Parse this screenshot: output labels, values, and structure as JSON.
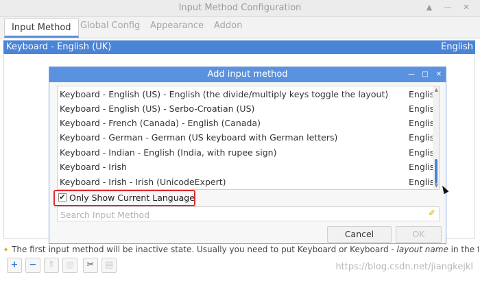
{
  "window": {
    "title": "Input Method Configuration",
    "controls": [
      "▲",
      "—",
      "✕"
    ]
  },
  "tabs": [
    {
      "label": "Input Method",
      "active": true
    },
    {
      "label": "Global Config",
      "active": false
    },
    {
      "label": "Appearance",
      "active": false
    },
    {
      "label": "Addon",
      "active": false
    }
  ],
  "main_list": {
    "selected": {
      "name": "Keyboard - English (UK)",
      "lang": "English"
    }
  },
  "dialog": {
    "title": "Add input method",
    "controls": [
      "—",
      "□",
      "✕"
    ],
    "items": [
      {
        "name": "Keyboard - English (US) - English (the divide/multiply keys toggle the layout)",
        "lang": "English"
      },
      {
        "name": "Keyboard - English (US) - Serbo-Croatian (US)",
        "lang": "English"
      },
      {
        "name": "Keyboard - French (Canada) - English (Canada)",
        "lang": "English"
      },
      {
        "name": "Keyboard - German - German (US keyboard with German letters)",
        "lang": "English"
      },
      {
        "name": "Keyboard - Indian - English (India, with rupee sign)",
        "lang": "English"
      },
      {
        "name": "Keyboard - Irish",
        "lang": "English"
      },
      {
        "name": "Keyboard - Irish - Irish (UnicodeExpert)",
        "lang": "English"
      }
    ],
    "checkbox": {
      "label": "Only Show Current Language",
      "checked": true
    },
    "search": {
      "placeholder": "Search Input Method",
      "value": ""
    },
    "buttons": {
      "cancel": "Cancel",
      "ok": "OK"
    }
  },
  "note": {
    "prefix": "The first input method will be inactive state. Usually you need to put ",
    "b1": "Keyboard",
    "mid": " or ",
    "b2": "Keyboard - ",
    "italic": "layout name",
    "suffix": " in the first place."
  },
  "toolbar": {
    "icons": [
      "add-icon",
      "remove-icon",
      "move-up-icon",
      "move-down-icon",
      "configure-icon",
      "keyboard-layout-icon"
    ]
  },
  "watermark": "https://blog.csdn.net/jiangkejkl",
  "colors": {
    "accent": "#4a84d6",
    "dialog_title": "#5b92df",
    "highlight": "#e0272f"
  }
}
